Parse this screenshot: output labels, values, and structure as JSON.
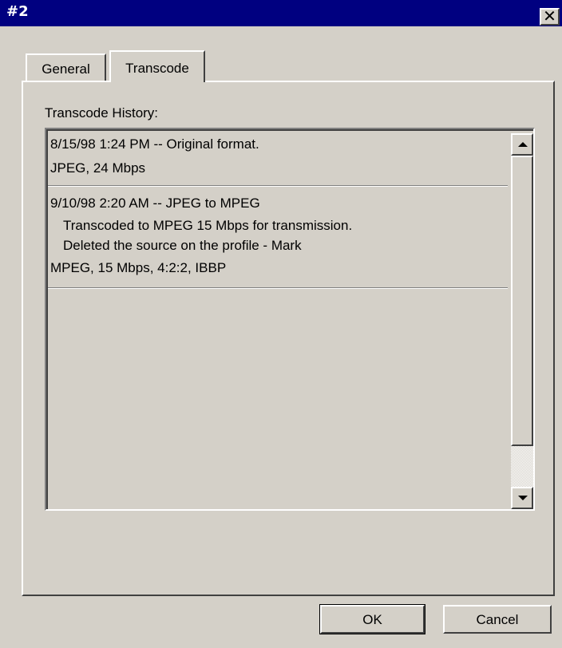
{
  "window": {
    "title": "#2",
    "close_glyph": "✕"
  },
  "tabs": [
    {
      "label": "General",
      "selected": false
    },
    {
      "label": "Transcode",
      "selected": true
    }
  ],
  "history": {
    "label": "Transcode History:",
    "entries": [
      {
        "heading": "8/15/98 1:24 PM -- Original format.",
        "notes": [],
        "format": "JPEG, 24 Mbps"
      },
      {
        "heading": "9/10/98 2:20 AM -- JPEG to MPEG",
        "notes": [
          "Transcoded to MPEG 15 Mbps for transmission.",
          "Deleted the source on the profile - Mark"
        ],
        "format": "MPEG, 15 Mbps, 4:2:2, IBBP"
      }
    ]
  },
  "buttons": {
    "ok": "OK",
    "cancel": "Cancel"
  },
  "icons": {
    "close": "close-icon",
    "scroll_up": "up-arrow-icon",
    "scroll_down": "down-arrow-icon"
  },
  "colors": {
    "titlebar": "#000080",
    "face": "#d4d0c8"
  }
}
